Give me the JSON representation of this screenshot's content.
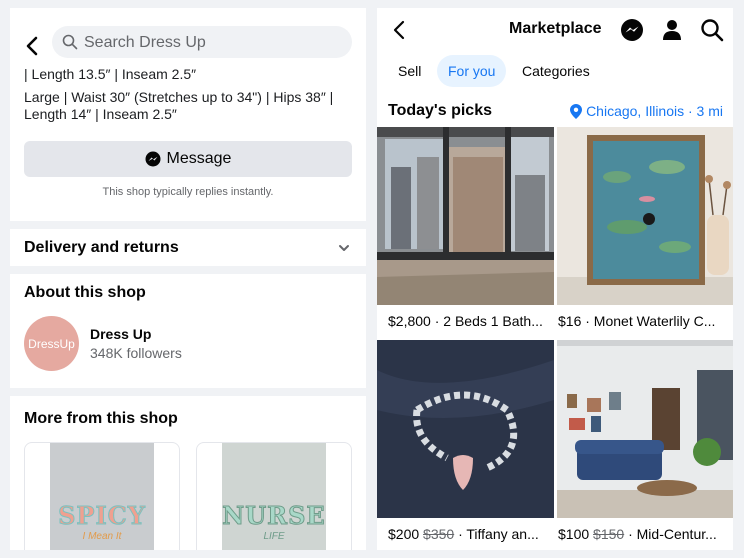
{
  "left": {
    "search": {
      "placeholder": "Search Dress Up"
    },
    "description_lines": [
      "| Length 13.5″ | Inseam 2.5″",
      "Large | Waist 30″ (Stretches up to 34\") | Hips 38″ |",
      "Length 14″ | Inseam 2.5″"
    ],
    "message_button": "Message",
    "reply_note": "This shop typically replies instantly.",
    "delivery_title": "Delivery and returns",
    "about_title": "About this shop",
    "shop": {
      "logo_text": "DressUp",
      "name": "Dress Up",
      "followers": "348K followers"
    },
    "more_title": "More from this shop",
    "products": [
      {
        "print_text": "SPICY",
        "print_sub": "I Mean It"
      },
      {
        "print_text": "NURSE",
        "print_sub": "LIFE"
      }
    ]
  },
  "right": {
    "title": "Marketplace",
    "icons": [
      "messenger-icon",
      "profile-icon",
      "search-icon"
    ],
    "tabs": [
      "Sell",
      "For you",
      "Categories"
    ],
    "active_tab": "For you",
    "picks_title": "Today's picks",
    "location": "Chicago, Illinois · 3 mi",
    "listings": [
      {
        "price": "$2,800",
        "old_price": "",
        "title": "· 2 Beds 1 Bath..."
      },
      {
        "price": "$16",
        "old_price": "",
        "title": "· Monet Waterlily C..."
      },
      {
        "price": "$200",
        "old_price": "$350",
        "title": "· Tiffany an..."
      },
      {
        "price": "$100",
        "old_price": "$150",
        "title": "· Mid-Centur..."
      }
    ]
  },
  "colors": {
    "accent": "#1877f2",
    "background": "#f0f2f5",
    "button": "#e4e6eb",
    "logo": "#e5a9a0"
  }
}
